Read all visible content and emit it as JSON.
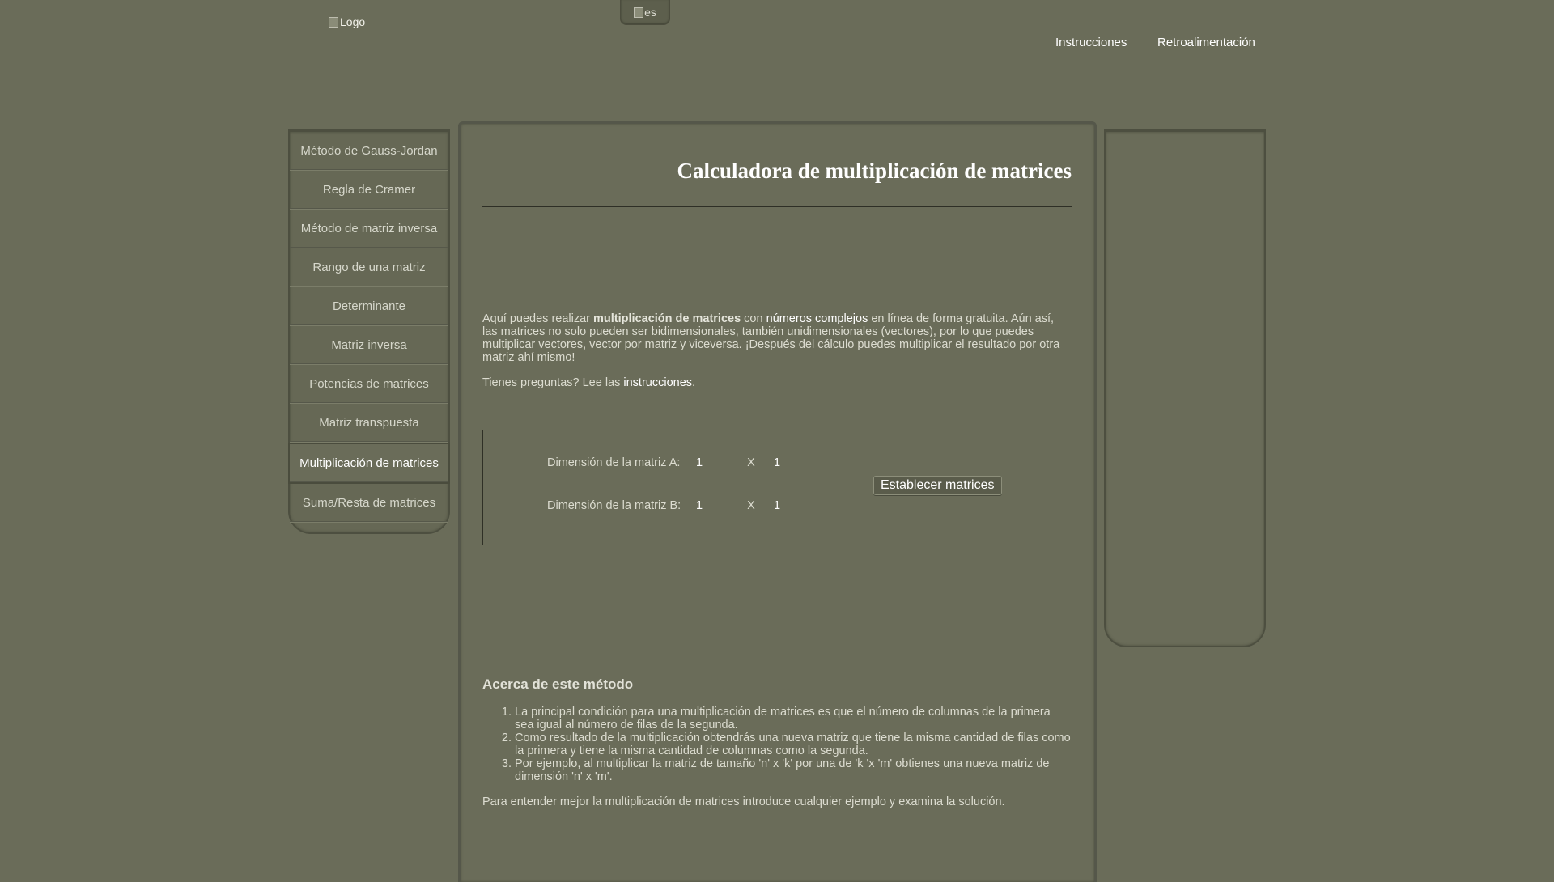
{
  "header": {
    "logo_alt": "Logo",
    "language_alt": "es",
    "nav": [
      "Instrucciones",
      "Retroalimentación"
    ]
  },
  "sidebar": {
    "items": [
      "Método de Gauss-Jordan",
      "Regla de Cramer",
      "Método de matriz inversa",
      "Rango de una matriz",
      "Determinante",
      "Matriz inversa",
      "Potencias de matrices",
      "Matriz transpuesta",
      "Multiplicación de matrices",
      "Suma/Resta de matrices"
    ],
    "active_index": 8
  },
  "main": {
    "title": "Calculadora de multiplicación de matrices",
    "intro": {
      "p1": "Aquí puedes realizar ",
      "bold": "multiplicación de matrices",
      "p2": " con ",
      "link": "números complejos",
      "p3": " en línea de forma gratuita. Aún así, las matrices no solo pueden ser bidimensionales, también unidimensionales (vectores), por lo que puedes multiplicar vectores, vector por matriz y viceversa. ¡Después del cálculo puedes multiplicar el resultado por otra matriz ahí mismo!"
    },
    "help": {
      "prefix": "Tienes preguntas? Lee las ",
      "link": "instrucciones",
      "suffix": "."
    },
    "calculator": {
      "matrix_a_label": "Dimensión de la matriz A:",
      "matrix_a_rows": "1",
      "matrix_a_cols": "1",
      "matrix_b_label": "Dimensión de la matriz B:",
      "matrix_b_rows": "1",
      "matrix_b_cols": "1",
      "times": "X",
      "button": "Establecer matrices"
    },
    "about": {
      "title": "Acerca de este método",
      "items": [
        "La principal condición para una multiplicación de matrices es que el número de columnas de la primera sea igual al número de filas de la segunda.",
        "Como resultado de la multiplicación obtendrás una nueva matriz que tiene la misma cantidad de filas como la primera y tiene la misma cantidad de columnas como la segunda.",
        "Por ejemplo, al multiplicar la matriz de tamaño 'n' x 'k' por una de 'k 'x 'm' obtienes una nueva matriz de dimensión 'n' x 'm'."
      ],
      "outro": "Para entender mejor la multiplicación de matrices introduce cualquier ejemplo y examina la solución."
    }
  }
}
